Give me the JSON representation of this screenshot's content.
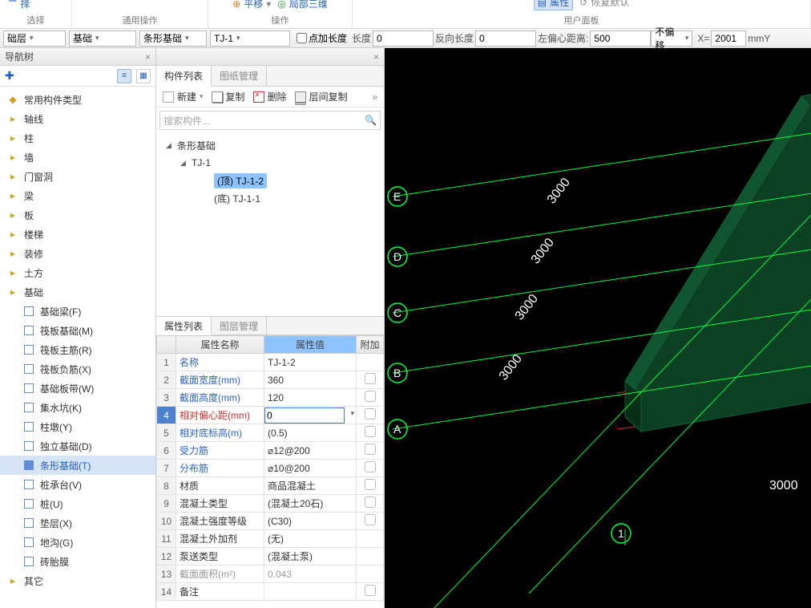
{
  "ribbon": {
    "btn_sel": "按属性选择",
    "grp_select": "选择",
    "grp_general": "通用操作",
    "btn_move": "平移",
    "btn_local3d": "局部三维",
    "grp_op": "操作",
    "btn_prop": "属性",
    "btn_restore": "恢复默认",
    "grp_panel": "用户面板"
  },
  "fbar": {
    "layer": "础层",
    "cat": "基础",
    "type": "条形基础",
    "comp": "TJ-1",
    "pt_add": "点加长度",
    "len_lbl": "长度",
    "len_v": "0",
    "rev_lbl": "反向长度",
    "rev_v": "0",
    "off_lbl": "左偏心距离:",
    "off_v": "500",
    "noshift": "不偏移",
    "x_lbl": "X=",
    "x_v": "2001",
    "unit": "mmY"
  },
  "nav": {
    "title": "导航树",
    "root": "常用构件类型",
    "items": [
      "轴线",
      "柱",
      "墙",
      "门窗洞",
      "梁",
      "板",
      "楼梯",
      "装修",
      "土方",
      "基础"
    ],
    "foundation_children": [
      {
        "lbl": "基础梁(F)"
      },
      {
        "lbl": "筏板基础(M)"
      },
      {
        "lbl": "筏板主筋(R)"
      },
      {
        "lbl": "筏板负筋(X)"
      },
      {
        "lbl": "基础板带(W)"
      },
      {
        "lbl": "集水坑(K)"
      },
      {
        "lbl": "柱墩(Y)"
      },
      {
        "lbl": "独立基础(D)"
      },
      {
        "lbl": "条形基础(T)",
        "sel": true
      },
      {
        "lbl": "桩承台(V)"
      },
      {
        "lbl": "桩(U)"
      },
      {
        "lbl": "垫层(X)"
      },
      {
        "lbl": "地沟(G)"
      },
      {
        "lbl": "砖胎膜"
      }
    ],
    "other": "其它"
  },
  "complist": {
    "tab1": "构件列表",
    "tab2": "图纸管理",
    "new": "新建",
    "copy": "复制",
    "del": "删除",
    "lyrcopy": "层间复制",
    "search_ph": "搜索构件...",
    "root": "条形基础",
    "c1": "TJ-1",
    "c1a": "(顶) TJ-1-2",
    "c1b": "(底) TJ-1-1"
  },
  "prop": {
    "tab1": "属性列表",
    "tab2": "图层管理",
    "h_name": "属性名称",
    "h_val": "属性值",
    "h_add": "附加",
    "rows": [
      {
        "n": "名称",
        "v": "TJ-1-2",
        "link": 1,
        "chk": 0
      },
      {
        "n": "截面宽度(mm)",
        "v": "360",
        "link": 1,
        "chk": 1
      },
      {
        "n": "截面高度(mm)",
        "v": "120",
        "link": 1,
        "chk": 1
      },
      {
        "n": "相对偏心距(mm)",
        "v": "0",
        "link": 1,
        "chk": 1,
        "edit": 1
      },
      {
        "n": "相对底标高(m)",
        "v": "(0.5)",
        "link": 1,
        "chk": 1
      },
      {
        "n": "受力筋",
        "v": "⌀12@200",
        "link": 1,
        "chk": 1
      },
      {
        "n": "分布筋",
        "v": "⌀10@200",
        "link": 1,
        "chk": 1
      },
      {
        "n": "材质",
        "v": "商品混凝土",
        "chk": 1
      },
      {
        "n": "混凝土类型",
        "v": "(混凝土20石)",
        "chk": 1
      },
      {
        "n": "混凝土强度等级",
        "v": "(C30)",
        "chk": 1
      },
      {
        "n": "混凝土外加剂",
        "v": "(无)",
        "chk": 0
      },
      {
        "n": "泵送类型",
        "v": "(混凝土泵)",
        "chk": 0
      },
      {
        "n": "截面面积(m²)",
        "v": "0.043",
        "dim": 1,
        "chk": 0
      },
      {
        "n": "备注",
        "v": "",
        "chk": 1
      }
    ]
  },
  "v3": {
    "axes": [
      "A",
      "B",
      "C",
      "D",
      "E"
    ],
    "num": "1",
    "dim": "3000"
  }
}
